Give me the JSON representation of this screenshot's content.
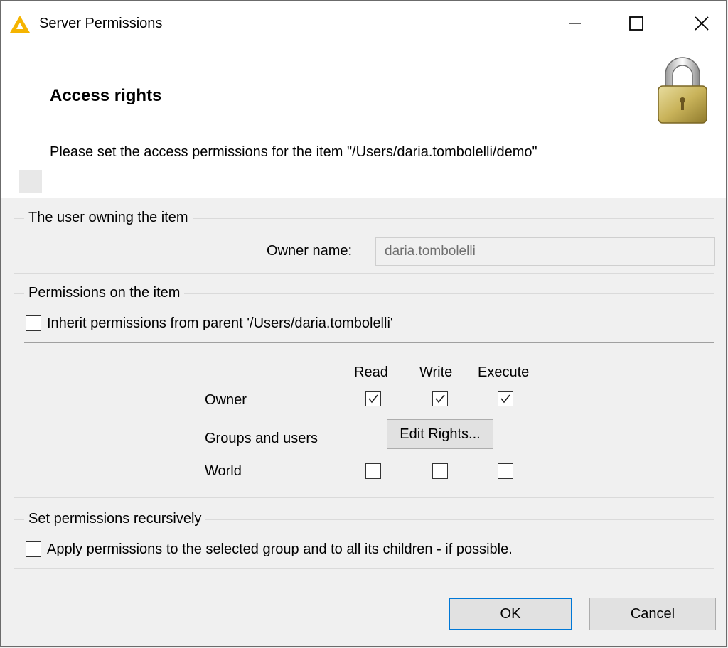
{
  "window": {
    "title": "Server Permissions"
  },
  "header": {
    "title": "Access rights",
    "description": "Please set the access permissions for the item  \"/Users/daria.tombolelli/demo\""
  },
  "owner_group": {
    "title": "The user owning the item",
    "owner_label": "Owner name:",
    "owner_value": "daria.tombolelli"
  },
  "permissions_group": {
    "title": "Permissions on the item",
    "inherit_label": "Inherit permissions from parent '/Users/daria.tombolelli'",
    "inherit_checked": false,
    "columns": [
      "Read",
      "Write",
      "Execute"
    ],
    "rows": [
      {
        "label": "Owner",
        "read": true,
        "write": true,
        "execute": true
      },
      {
        "label": "Groups and users",
        "button": "Edit Rights..."
      },
      {
        "label": "World",
        "read": false,
        "write": false,
        "execute": false
      }
    ]
  },
  "recursive_group": {
    "title": "Set permissions recursively",
    "apply_label": "Apply permissions to the selected group and to all its children - if possible.",
    "apply_checked": false
  },
  "buttons": {
    "ok": "OK",
    "cancel": "Cancel"
  },
  "colors": {
    "accent": "#0078d7",
    "icon": "#f5b400"
  }
}
